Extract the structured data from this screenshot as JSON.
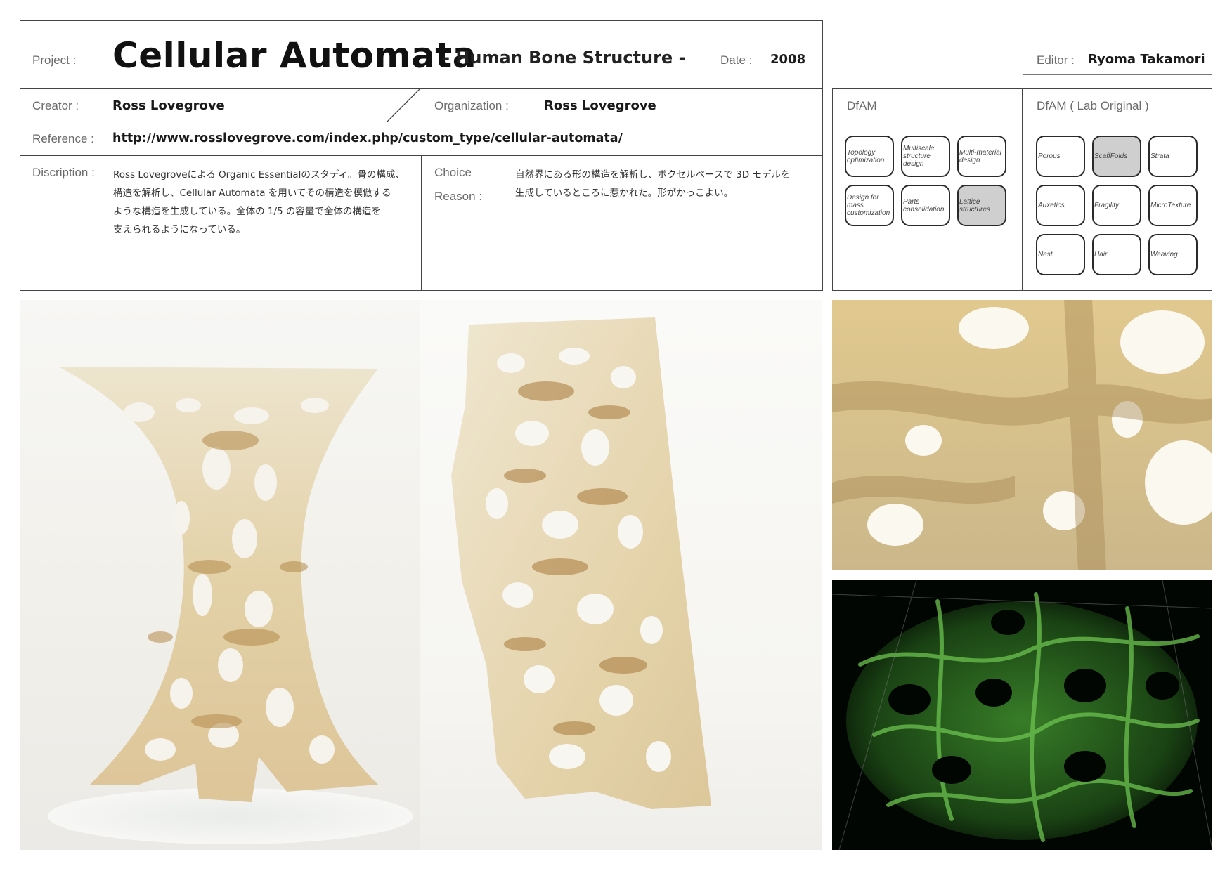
{
  "header": {
    "project_label": "Project :",
    "project_title": "Cellular Automata",
    "project_subtitle": "- Human Bone Structure -",
    "date_label": "Date :",
    "date_value": "2008",
    "editor_label": "Editor :",
    "editor_value": "Ryoma Takamori"
  },
  "info": {
    "creator_label": "Creator :",
    "creator_value": "Ross Lovegrove",
    "organization_label": "Organization :",
    "organization_value": "Ross Lovegrove",
    "reference_label": "Reference :",
    "reference_value": "http://www.rosslovegrove.com/index.php/custom_type/cellular-automata/",
    "description_label": "Discription :",
    "description_lines": [
      "Ross Lovegroveによる Organic Essentialのスタディ。骨の構成、",
      "構造を解析し、Cellular Automata を用いてその構造を模倣する",
      "ような構造を生成している。全体の 1/5 の容量で全体の構造を",
      "支えられるようになっている。"
    ],
    "choice_label_1": "Choice",
    "choice_label_2": "Reason :",
    "choice_lines": [
      "自然界にある形の構造を解析し、ボクセルベースで 3D モデルを",
      "生成しているところに惹かれた。形がかっこよい。"
    ]
  },
  "dfam": {
    "title": "DfAM",
    "lab_title": "DfAM ( Lab Original )",
    "tiles": [
      {
        "label": "Topology optimization",
        "selected": false
      },
      {
        "label": "Multiscale structure design",
        "selected": false
      },
      {
        "label": "Multi-material design",
        "selected": false
      },
      {
        "label": "Design for mass customization",
        "selected": false
      },
      {
        "label": "Parts consolidation",
        "selected": false
      },
      {
        "label": "Lattice structures",
        "selected": true
      }
    ],
    "lab_tiles": [
      {
        "label": "Porous",
        "selected": false
      },
      {
        "label": "ScaffFolds",
        "selected": true
      },
      {
        "label": "Strata",
        "selected": false
      },
      {
        "label": "Auxetics",
        "selected": false
      },
      {
        "label": "Fragility",
        "selected": false
      },
      {
        "label": "MicroTexture",
        "selected": false
      },
      {
        "label": "Nest",
        "selected": false
      },
      {
        "label": "Hair",
        "selected": false
      },
      {
        "label": "Weaving",
        "selected": false
      }
    ]
  },
  "colors": {
    "border": "#444444",
    "label": "#6b6b6b",
    "selected_tile": "#cfcfcf",
    "bone_light": "#f1e6c8",
    "bone_dark": "#a8783a",
    "voxel_green": "#4fae3a"
  }
}
